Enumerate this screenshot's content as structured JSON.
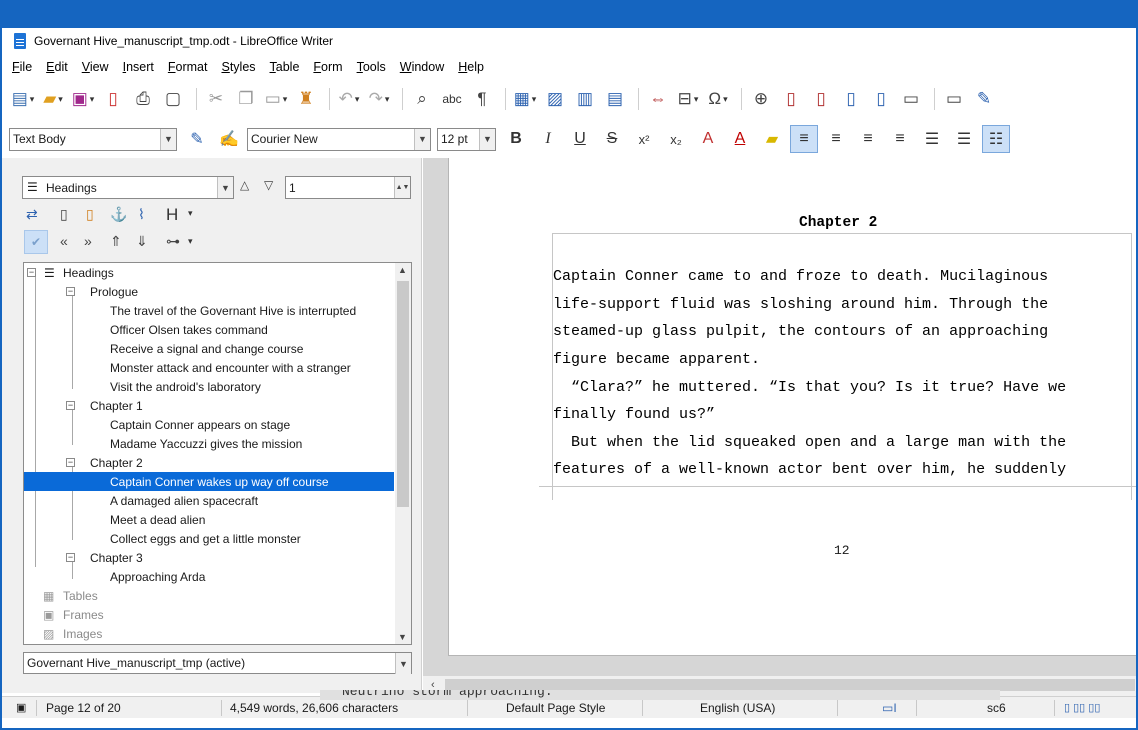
{
  "window": {
    "title": "Governant Hive_manuscript_tmp.odt - LibreOffice Writer"
  },
  "menu": [
    "File",
    "Edit",
    "View",
    "Insert",
    "Format",
    "Styles",
    "Table",
    "Form",
    "Tools",
    "Window",
    "Help"
  ],
  "toolbar": {
    "paragraph_style": "Text Body",
    "font_name": "Courier New",
    "font_size": "12 pt",
    "bold": "B",
    "italic": "I",
    "underline": "U",
    "strike": "S",
    "spellcheck_label": "abc"
  },
  "navigator": {
    "category": "Headings",
    "level": "1",
    "tree": {
      "root": "Headings",
      "chapters": [
        {
          "title": "Prologue",
          "items": [
            "The travel of the Governant Hive is interrupted",
            "Officer Olsen takes command",
            "Receive a signal and change course",
            "Monster attack and encounter with a stranger",
            "Visit the android's laboratory"
          ]
        },
        {
          "title": "Chapter 1",
          "items": [
            "Captain Conner appears on stage",
            "Madame Yaccuzzi gives the mission"
          ]
        },
        {
          "title": "Chapter 2",
          "items": [
            "Captain Conner wakes up way off course",
            "A damaged alien spacecraft",
            "Meet a dead alien",
            "Collect eggs and get a little monster"
          ]
        },
        {
          "title": "Chapter 3",
          "items": [
            "Approaching Arda"
          ]
        }
      ],
      "other": [
        "Tables",
        "Frames",
        "Images"
      ]
    },
    "document": "Governant Hive_manuscript_tmp (active)"
  },
  "document": {
    "chapter_heading": "Chapter 2",
    "paragraphs": [
      "Captain Conner came to and froze to death. Mucilaginous",
      "life-support fluid was sloshing around him. Through the",
      "steamed-up glass pulpit, the contours of an approaching",
      "figure became apparent.",
      "  “Clara?” he muttered. “Is that you? Is it true? Have we",
      "finally found us?”",
      "  But when the lid squeaked open and a large man with the",
      "features of a well-known actor bent over him, he suddenly"
    ],
    "page_number": "12"
  },
  "status": {
    "page": "Page 12 of 20",
    "words": "4,549 words, 26,606 characters",
    "page_style": "Default Page Style",
    "language": "English (USA)",
    "cell": "sc6"
  },
  "underlap_text": "Neutrino storm approaching."
}
